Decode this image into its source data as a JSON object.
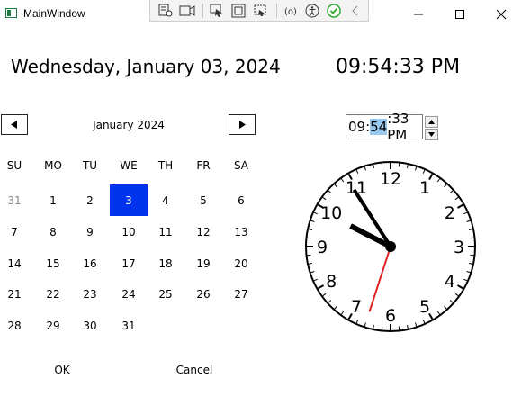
{
  "window": {
    "title": "MainWindow",
    "icon": "wpf-window-icon"
  },
  "toolbar": {
    "icons": [
      "live-visual-tree-icon",
      "record-icon",
      "select-element-icon",
      "display-layout-adorners-icon",
      "track-focused-element-icon",
      "binding-failures-icon",
      "accessibility-icon",
      "checkmark-icon",
      "collapse-chevron-icon"
    ]
  },
  "header": {
    "date": "Wednesday, January 03, 2024",
    "time": "09:54:33 PM"
  },
  "calendar": {
    "month_label": "January 2024",
    "days_of_week": [
      "SU",
      "MO",
      "TU",
      "WE",
      "TH",
      "FR",
      "SA"
    ],
    "weeks": [
      [
        "31",
        "1",
        "2",
        "3",
        "4",
        "5",
        "6"
      ],
      [
        "7",
        "8",
        "9",
        "10",
        "11",
        "12",
        "13"
      ],
      [
        "14",
        "15",
        "16",
        "17",
        "18",
        "19",
        "20"
      ],
      [
        "21",
        "22",
        "23",
        "24",
        "25",
        "26",
        "27"
      ],
      [
        "28",
        "29",
        "30",
        "31",
        "",
        "",
        ""
      ]
    ],
    "selected_day": "3",
    "selected_color": "#0033EE"
  },
  "time_picker": {
    "hour": "09",
    "sep1": ":",
    "minute": "54",
    "rest": ":33 PM"
  },
  "clock": {
    "numbers": [
      "12",
      "1",
      "2",
      "3",
      "4",
      "5",
      "6",
      "7",
      "8",
      "9",
      "10",
      "11"
    ],
    "hours": 21,
    "minutes": 54,
    "seconds": 33,
    "second_hand_color": "#E02020"
  },
  "footer": {
    "ok_label": "OK",
    "cancel_label": "Cancel"
  }
}
